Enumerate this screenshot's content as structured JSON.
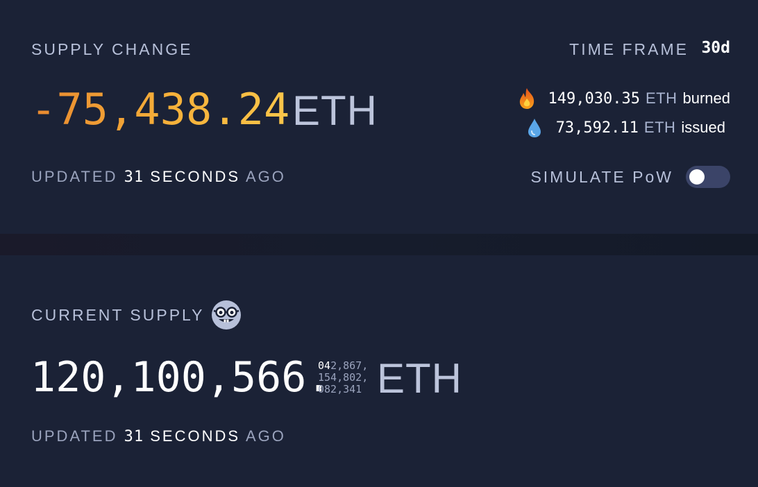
{
  "supply_change": {
    "title": "SUPPLY CHANGE",
    "time_frame_label": "TIME FRAME",
    "time_frame_value": "30d",
    "value": "-75,438.24",
    "unit": "ETH",
    "burned": {
      "icon": "fire-icon",
      "value": "149,030.35",
      "unit": "ETH",
      "word": "burned"
    },
    "issued": {
      "icon": "droplet-icon",
      "value": "73,592.11",
      "unit": "ETH",
      "word": "issued"
    },
    "updated": {
      "prefix": "UPDATED",
      "number": "31",
      "unit": "SECONDS",
      "suffix": "AGO"
    },
    "simulate_label": "SIMULATE PoW",
    "simulate_enabled": false
  },
  "current_supply": {
    "title": "CURRENT SUPPLY",
    "icon": "nerd-face-icon",
    "integer": "120,100,566.",
    "decimals_lead": "04",
    "decimals_line1": "2,867,",
    "decimals_line2": "154,802,",
    "decimals_line3": "082,341",
    "unit": "ETH",
    "updated": {
      "prefix": "UPDATED",
      "number": "31",
      "unit": "SECONDS",
      "suffix": "AGO"
    }
  },
  "colors": {
    "background": "#1b2236",
    "accent_orange": "#f6b13a",
    "label": "#b7c0d9",
    "toggle_track": "#3b4468"
  }
}
